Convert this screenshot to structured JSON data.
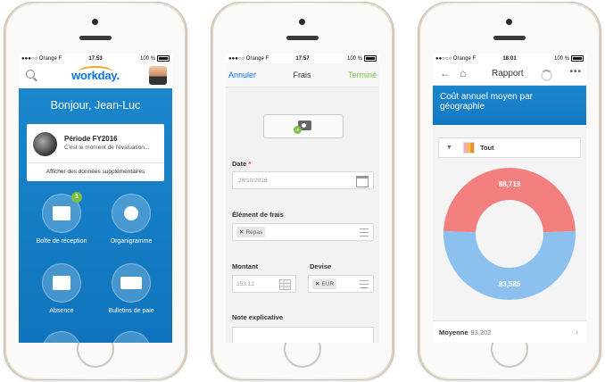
{
  "phone1": {
    "status": {
      "carrier": "●●●○○ Orange F",
      "time": "17:53",
      "battery": "100 %"
    },
    "header": {
      "logo": "workday."
    },
    "greeting": "Bonjour, Jean-Luc",
    "card": {
      "title": "Période FY2016",
      "subtitle": "C'est le moment de l'évaluation...",
      "more": "Afficher des données supplémentaires"
    },
    "tiles": [
      {
        "label": "Boîte de réception",
        "badge": "1",
        "icon": "inbox-icon"
      },
      {
        "label": "Organigramme",
        "icon": "org-chart-icon"
      },
      {
        "label": "Absence",
        "icon": "suitcase-icon"
      },
      {
        "label": "Bulletins de paie",
        "icon": "payslip-icon"
      }
    ]
  },
  "phone2": {
    "status": {
      "carrier": "●●●○○ Orange F",
      "time": "17:57",
      "battery": "100 %"
    },
    "nav": {
      "cancel": "Annuler",
      "title": "Frais",
      "done": "Terminé"
    },
    "date": {
      "label": "Date",
      "required": "*",
      "value": "28/10/2016"
    },
    "expense_item": {
      "label": "Élément de frais",
      "chip": "Repas"
    },
    "amount": {
      "label": "Montant",
      "value": "153,12"
    },
    "currency": {
      "label": "Devise",
      "chip": "EUR"
    },
    "note": {
      "label": "Note explicative",
      "value": ""
    }
  },
  "phone3": {
    "status": {
      "carrier": "●●○○○ Orange F",
      "time": "18:01",
      "battery": "100 %"
    },
    "nav": {
      "title": "Rapport",
      "more": "•••"
    },
    "banner": "Coût annuel moyen par géographie",
    "filter": {
      "value": "Tout"
    },
    "footer": {
      "label": "Moyenne",
      "value": "93,202"
    }
  },
  "chart_data": {
    "type": "pie",
    "donut": true,
    "slices": [
      {
        "label": "88,719",
        "value": 88719,
        "color": "#f47f7f"
      },
      {
        "label": "93,585",
        "value": 93585,
        "color": "#8cc1ef"
      }
    ]
  }
}
